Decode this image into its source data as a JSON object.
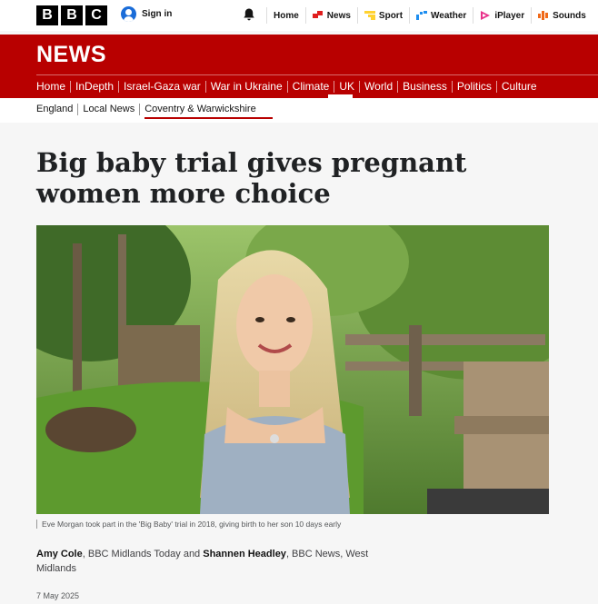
{
  "masthead": {
    "logo_letters": [
      "B",
      "B",
      "C"
    ],
    "signin_label": "Sign in",
    "nav": [
      {
        "label": "Home",
        "icon": "none"
      },
      {
        "label": "News",
        "icon": "news-icon",
        "color": "#e01e1e"
      },
      {
        "label": "Sport",
        "icon": "sport-icon",
        "color": "#ffd230"
      },
      {
        "label": "Weather",
        "icon": "weather-icon",
        "color": "#1e8ef0"
      },
      {
        "label": "iPlayer",
        "icon": "iplayer-icon",
        "color": "#e8308a"
      },
      {
        "label": "Sounds",
        "icon": "sounds-icon",
        "color": "#f06a1a"
      }
    ]
  },
  "section": {
    "title": "NEWS",
    "nav": [
      "Home",
      "InDepth",
      "Israel-Gaza war",
      "War in Ukraine",
      "Climate",
      "UK",
      "World",
      "Business",
      "Politics",
      "Culture"
    ],
    "active": "UK",
    "subnav": [
      "England",
      "Local News",
      "Coventry & Warwickshire"
    ],
    "subnav_active": "Coventry & Warwickshire"
  },
  "colors": {
    "brand": "#b80000",
    "background": "#f6f6f6"
  },
  "article": {
    "headline": "Big baby trial gives pregnant women more choice",
    "caption": "Eve Morgan took part in the 'Big Baby' trial in 2018, giving birth to her son 10 days early",
    "byline": {
      "author1": "Amy Cole",
      "org1": ", BBC Midlands Today and ",
      "author2": "Shannen Headley",
      "org2": ", BBC News, West Midlands"
    },
    "date": "7 May 2025"
  }
}
